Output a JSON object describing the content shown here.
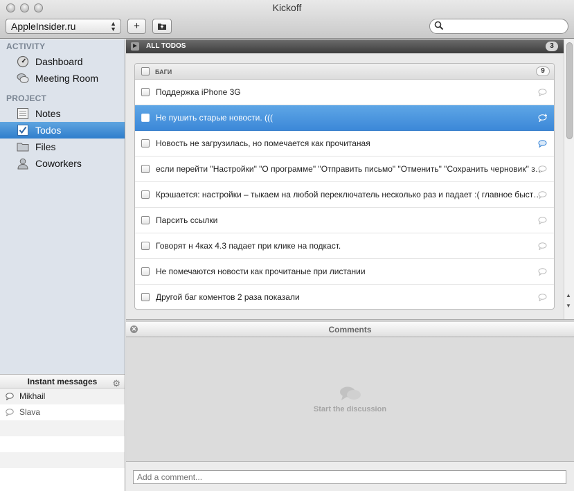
{
  "window": {
    "title": "Kickoff"
  },
  "toolbar": {
    "project": "AppleInsider.ru",
    "add_label": "+",
    "search_placeholder": ""
  },
  "sidebar": {
    "sections": [
      {
        "title": "ACTIVITY",
        "items": [
          {
            "label": "Dashboard",
            "icon": "dashboard-icon"
          },
          {
            "label": "Meeting Room",
            "icon": "chat-bubbles-icon"
          }
        ]
      },
      {
        "title": "PROJECT",
        "items": [
          {
            "label": "Notes",
            "icon": "notes-icon"
          },
          {
            "label": "Todos",
            "icon": "checkbox-icon",
            "active": true
          },
          {
            "label": "Files",
            "icon": "folder-icon"
          },
          {
            "label": "Coworkers",
            "icon": "person-icon"
          }
        ]
      }
    ]
  },
  "instant_messages": {
    "title": "Instant messages",
    "users": [
      "Mikhail",
      "Slava"
    ]
  },
  "todos": {
    "bar_label": "ALL TODOS",
    "bar_count": "3",
    "group": {
      "name": "БАГИ",
      "count": "9"
    },
    "items": [
      {
        "text": "Поддержка iPhone 3G",
        "comment_state": "none"
      },
      {
        "text": "Не пушить старые новости. (((",
        "comment_state": "add",
        "selected": true
      },
      {
        "text": "Новость не загрузилась, но помечается как прочитаная",
        "comment_state": "has"
      },
      {
        "text": "если перейти \"Настройки\" \"О программе\" \"Отправить письмо\" \"Отменить\" \"Сохранить черновик\" зав…",
        "comment_state": "none"
      },
      {
        "text": "Крэшается: настройки – тыкаем на любой переключатель несколько раз и падает :( главное быстро…",
        "comment_state": "none"
      },
      {
        "text": "Парсить ссылки",
        "comment_state": "none"
      },
      {
        "text": "Говорят н 4ках 4.3 падает при клике на подкаст.",
        "comment_state": "none"
      },
      {
        "text": "Не помечаются новости как прочитаные при листании",
        "comment_state": "none"
      },
      {
        "text": "Другой баг коментов 2 раза показали",
        "comment_state": "none"
      }
    ]
  },
  "comments": {
    "title": "Comments",
    "empty_text": "Start the discussion",
    "input_placeholder": "Add a comment..."
  },
  "colors": {
    "selection": "#3c88d8",
    "sidebar_bg": "#dde3eb",
    "sidebar_active": "#2e7dcc",
    "comment_icon_active": "#3b86d6"
  }
}
